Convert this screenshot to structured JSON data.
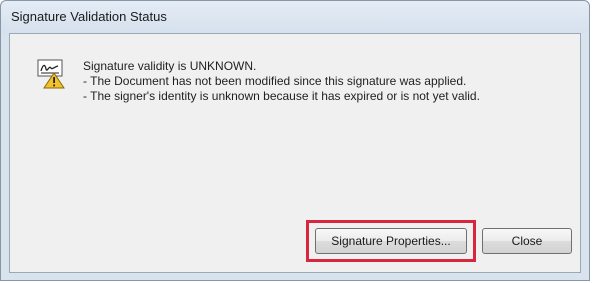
{
  "window": {
    "title": "Signature Validation Status"
  },
  "message": {
    "icon": "signature-warning-icon",
    "lines": [
      "Signature validity is UNKNOWN.",
      "- The Document has not been modified since this signature was applied.",
      "- The signer's identity is unknown because it has expired or is not yet valid."
    ]
  },
  "buttons": {
    "signature_properties": "Signature Properties...",
    "close": "Close"
  },
  "colors": {
    "highlight": "#d7263d",
    "warning": "#f2c12e"
  }
}
